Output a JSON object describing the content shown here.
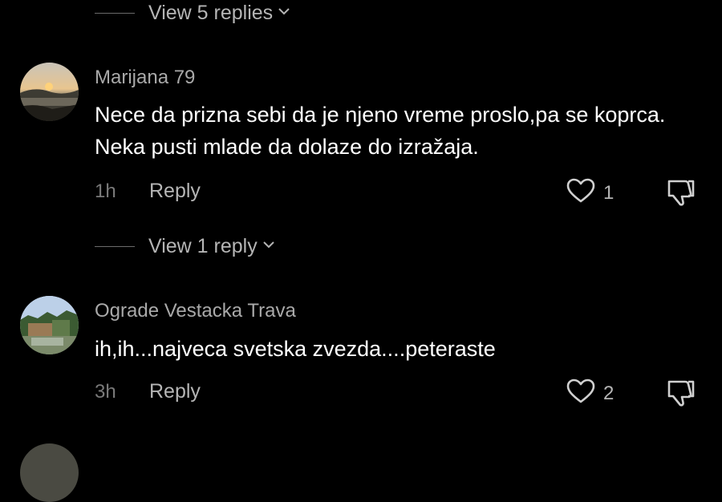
{
  "thread_top": {
    "view_replies_label": "View 5 replies"
  },
  "comments": [
    {
      "username": "Marijana 79",
      "text": "Nece da prizna sebi da je njeno vreme proslo,pa se koprca. Neka pusti mlade da dolaze do izražaja.",
      "time": "1h",
      "reply_label": "Reply",
      "likes": "1",
      "view_replies_label": "View 1 reply"
    },
    {
      "username": "Ograde Vestacka Trava",
      "text": "ih,ih...najveca svetska zvezda....peteraste",
      "time": "3h",
      "reply_label": "Reply",
      "likes": "2"
    }
  ],
  "icons": {
    "like": "heart-outline-icon",
    "dislike": "thumbs-down-icon",
    "expand": "chevron-down-icon"
  },
  "colors": {
    "background": "#000000",
    "username": "#a9a9a9",
    "secondary": "#b5b5b5",
    "text": "#ffffff"
  }
}
